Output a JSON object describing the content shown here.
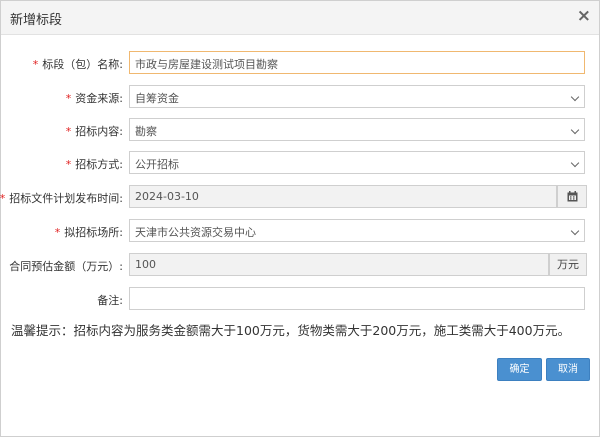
{
  "dialog": {
    "title": "新增标段",
    "close_glyph": "×"
  },
  "form": {
    "required_mark": "*",
    "fields": [
      {
        "label": "标段（包）名称:",
        "value": "市政与房屋建设测试项目勘察"
      },
      {
        "label": "资金来源:",
        "value": "自筹资金"
      },
      {
        "label": "招标内容:",
        "value": "勘察"
      },
      {
        "label": "招标方式:",
        "value": "公开招标"
      },
      {
        "label": "招标文件计划发布时间:",
        "value": "2024-03-10"
      },
      {
        "label": "拟招标场所:",
        "value": "天津市公共资源交易中心"
      },
      {
        "label": "合同预估金额（万元）:",
        "value": "100",
        "unit": "万元"
      },
      {
        "label": "备注:",
        "value": ""
      }
    ]
  },
  "tip": "温馨提示：招标内容为服务类金额需大于100万元，货物类需大于200万元，施工类需大于400万元。",
  "buttons": {
    "confirm": "确定",
    "cancel": "取消"
  },
  "icons": {
    "calendar": "calendar-icon",
    "dropdown": "chevron-down-icon",
    "close": "close-icon"
  }
}
